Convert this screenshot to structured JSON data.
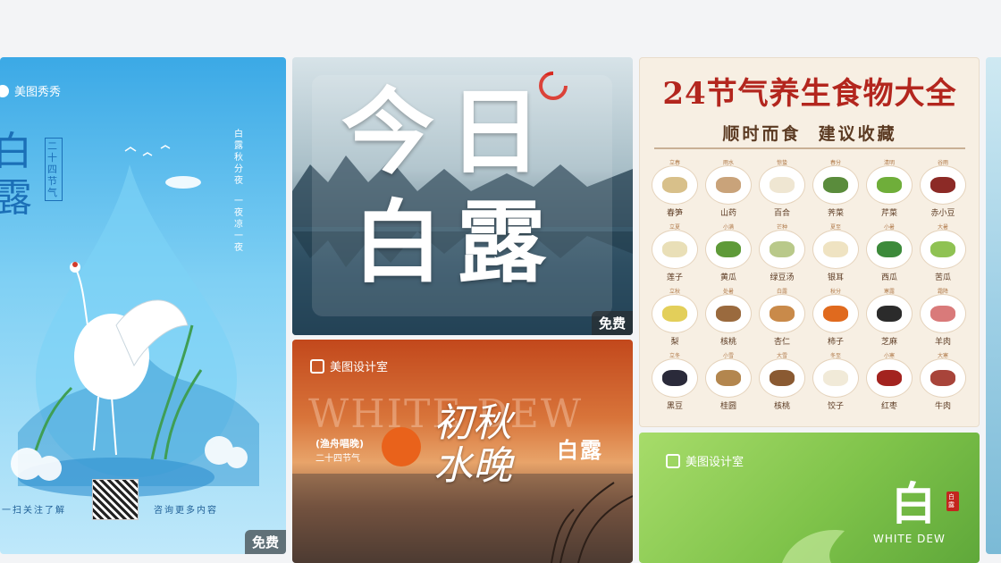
{
  "cards": [
    {
      "id": "bailu-poster-1",
      "brand": "美图秀秀",
      "big_title": "白露",
      "vertical_side": "二十四节气",
      "vertical_poem_1": "白露秋分夜",
      "vertical_poem_2": "一夜凉一夜",
      "footer_left": "一扫关注了解",
      "footer_right": "咨询更多内容",
      "badge": "免费"
    },
    {
      "id": "bailu-poster-2",
      "line1": "今日",
      "line2": "白露",
      "badge": "免费"
    },
    {
      "id": "food-guide",
      "title": "24节气养生食物大全",
      "subtitle": "顺时而食  建议收藏",
      "items": [
        {
          "top": "立春",
          "name": "春笋",
          "color": "#d8c08a"
        },
        {
          "top": "雨水",
          "name": "山药",
          "color": "#c9a37a"
        },
        {
          "top": "惊蛰",
          "name": "百合",
          "color": "#efe6d2"
        },
        {
          "top": "春分",
          "name": "荠菜",
          "color": "#5a8c3c"
        },
        {
          "top": "清明",
          "name": "芹菜",
          "color": "#6fae3a"
        },
        {
          "top": "谷雨",
          "name": "赤小豆",
          "color": "#8c2a26"
        },
        {
          "top": "立夏",
          "name": "莲子",
          "color": "#e9dfb7"
        },
        {
          "top": "小满",
          "name": "黄瓜",
          "color": "#5e9a38"
        },
        {
          "top": "芒种",
          "name": "绿豆汤",
          "color": "#b9c98a"
        },
        {
          "top": "夏至",
          "name": "银耳",
          "color": "#efe3c2"
        },
        {
          "top": "小暑",
          "name": "西瓜",
          "color": "#3c8a3a"
        },
        {
          "top": "大暑",
          "name": "苦瓜",
          "color": "#8fc253"
        },
        {
          "top": "立秋",
          "name": "梨",
          "color": "#e3cf5a"
        },
        {
          "top": "处暑",
          "name": "核桃",
          "color": "#9a6a3e"
        },
        {
          "top": "白露",
          "name": "杏仁",
          "color": "#c98a4a"
        },
        {
          "top": "秋分",
          "name": "柿子",
          "color": "#e06a1e"
        },
        {
          "top": "寒露",
          "name": "芝麻",
          "color": "#2b2b2b"
        },
        {
          "top": "霜降",
          "name": "羊肉",
          "color": "#d97a7a"
        },
        {
          "top": "立冬",
          "name": "黑豆",
          "color": "#2a2a3a"
        },
        {
          "top": "小雪",
          "name": "桂圆",
          "color": "#b3864e"
        },
        {
          "top": "大雪",
          "name": "核桃",
          "color": "#8a5a32"
        },
        {
          "top": "冬至",
          "name": "饺子",
          "color": "#f1ead8"
        },
        {
          "top": "小寒",
          "name": "红枣",
          "color": "#a3231f"
        },
        {
          "top": "大寒",
          "name": "牛肉",
          "color": "#a8443a"
        }
      ]
    },
    {
      "id": "chuqiu-poster",
      "brand": "美图设计室",
      "watermark": "WHITE DEW",
      "small_title": "(渔舟唱晚)",
      "small_sub": "二十四节气",
      "calligraphy": "初秋水晚",
      "right_title": "白露"
    },
    {
      "id": "green-poster",
      "brand": "美图设计室",
      "char": "白",
      "seal": "白露",
      "english": "WHITE DEW"
    }
  ],
  "colors": {
    "page_bg": "#f3f4f6",
    "blue_poster": "#5fc0ee",
    "food_title": "#b3261e",
    "green_poster": "#8ccd4e",
    "orange_poster": "#c8571f"
  }
}
